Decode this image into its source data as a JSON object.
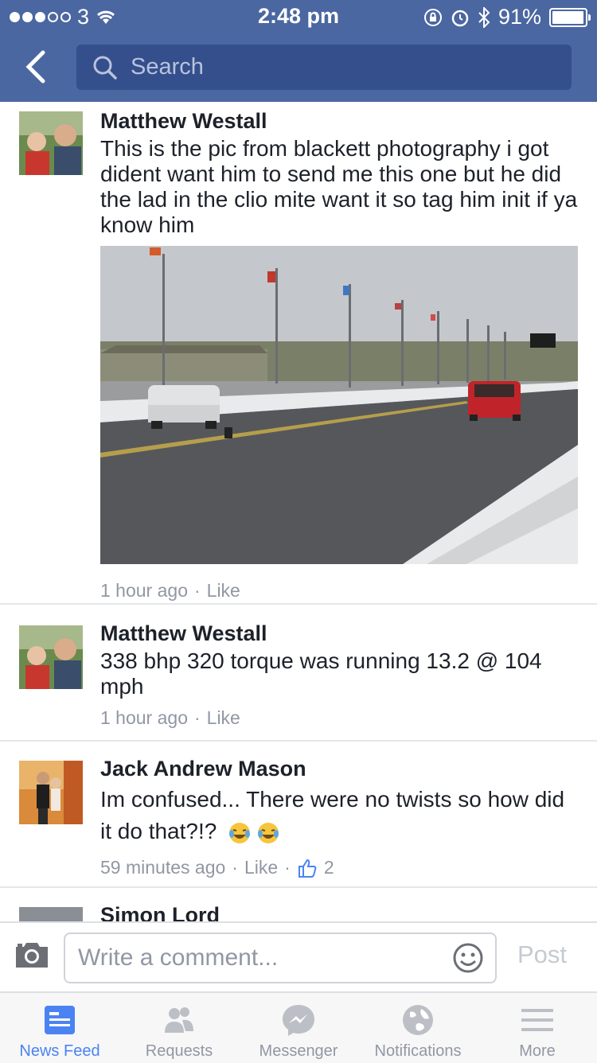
{
  "status_bar": {
    "carrier": "3",
    "time": "2:48 pm",
    "battery": "91%"
  },
  "nav": {
    "search_placeholder": "Search"
  },
  "comments": [
    {
      "author": "Matthew Westall",
      "text": "This is the pic from blackett photography i got dident want him to send me this one but he did the lad in the clio mite want it so tag him init if ya know him",
      "time": "1 hour ago",
      "like": "Like"
    },
    {
      "author": "Matthew Westall",
      "text": "338 bhp 320 torque  was running 13.2 @ 104 mph",
      "time": "1 hour ago",
      "like": "Like"
    },
    {
      "author": "Jack Andrew Mason",
      "text": "Im confused... There were no twists so how did it do that?!?",
      "time": "59 minutes ago",
      "like": "Like",
      "like_count": "2"
    },
    {
      "author": "Simon Lord"
    }
  ],
  "comment_bar": {
    "placeholder": "Write a comment...",
    "post_label": "Post"
  },
  "tabs": [
    {
      "label": "News Feed",
      "icon": "news-feed-icon",
      "active": true
    },
    {
      "label": "Requests",
      "icon": "friends-icon"
    },
    {
      "label": "Messenger",
      "icon": "messenger-icon"
    },
    {
      "label": "Notifications",
      "icon": "globe-icon"
    },
    {
      "label": "More",
      "icon": "menu-icon"
    }
  ],
  "colors": {
    "header": "#4b67a1",
    "search_bg": "#354f8d",
    "active_tab": "#4b83f3",
    "meta_text": "#9197a3"
  }
}
